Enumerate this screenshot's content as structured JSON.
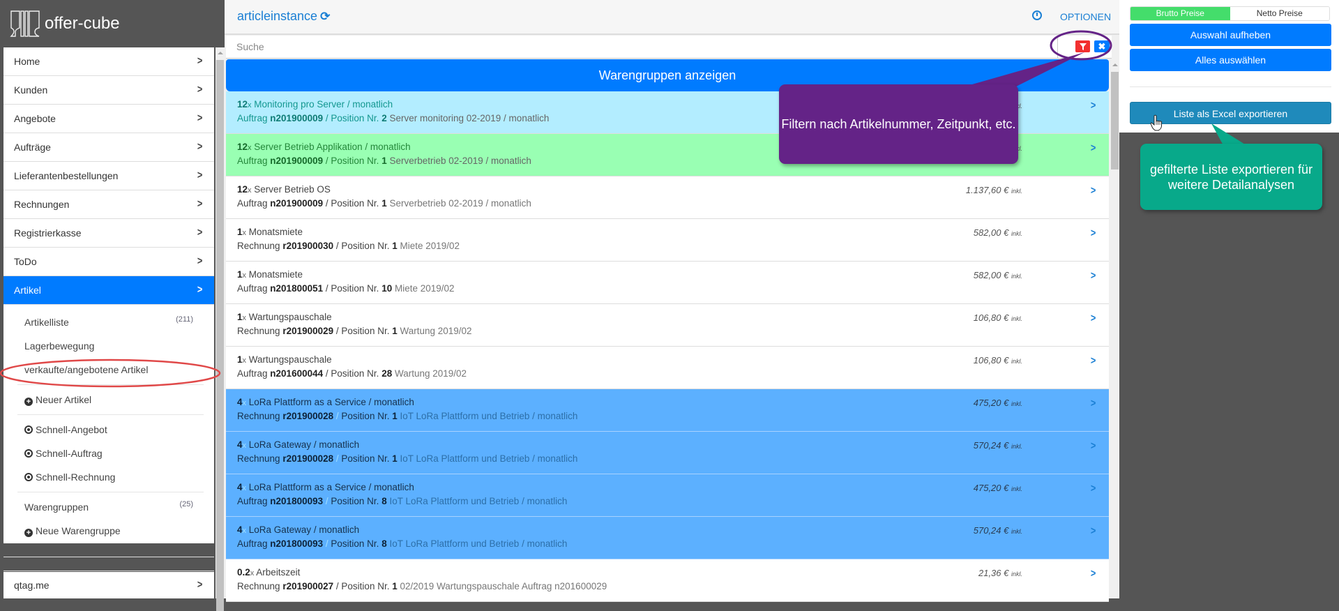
{
  "app": {
    "name": "offer-cube"
  },
  "sidebar": {
    "nav_items": [
      {
        "label": "Home"
      },
      {
        "label": "Kunden"
      },
      {
        "label": "Angebote"
      },
      {
        "label": "Aufträge"
      },
      {
        "label": "Lieferantenbestellungen"
      },
      {
        "label": "Rechnungen"
      },
      {
        "label": "Registrierkasse"
      },
      {
        "label": "ToDo"
      },
      {
        "label": "Artikel",
        "active": true
      }
    ],
    "sub_items": [
      {
        "label": "Artikelliste",
        "count": "(211)"
      },
      {
        "label": "Lagerbewegung"
      },
      {
        "label": "verkaufte/angebotene Artikel",
        "highlighted": true
      },
      {
        "label": "Neuer Artikel",
        "icon": "plus-circle-icon"
      },
      {
        "label": "Schnell-Angebot",
        "icon": "dot-circle-icon"
      },
      {
        "label": "Schnell-Auftrag",
        "icon": "dot-circle-icon"
      },
      {
        "label": "Schnell-Rechnung",
        "icon": "dot-circle-icon"
      },
      {
        "label": "Warengruppen",
        "count": "(25)"
      },
      {
        "label": "Neue Warengruppe",
        "icon": "plus-circle-icon"
      }
    ],
    "footer_item": {
      "label": "qtag.me"
    }
  },
  "main": {
    "title": "articleinstance",
    "options_label": "OPTIONEN",
    "search": {
      "placeholder": "Suche",
      "value": ""
    },
    "groups_button": "Warengruppen anzeigen",
    "rows": [
      {
        "style": "cyan",
        "qty": "12",
        "name": "Monitoring pro Server / monatlich",
        "doc_type": "Auftrag",
        "doc_no": "n201900009",
        "pos_label": "Position Nr.",
        "pos": "2",
        "desc": "Server monitoring 02-2019 / monatlich",
        "price": "",
        "inkl": "inkl."
      },
      {
        "style": "green",
        "qty": "12",
        "name": "Server Betrieb Applikation / monatlich",
        "doc_type": "Auftrag",
        "doc_no": "n201900009",
        "pos_label": "Position Nr.",
        "pos": "1",
        "desc": "Serverbetrieb 02-2019 / monatlich",
        "price": "",
        "inkl": "inkl."
      },
      {
        "style": "white",
        "qty": "12",
        "name": "Server Betrieb OS",
        "doc_type": "Auftrag",
        "doc_no": "n201900009",
        "pos_label": "Position Nr.",
        "pos": "1",
        "desc": "Serverbetrieb 02-2019 / monatlich",
        "price": "1.137,60 €",
        "inkl": "inkl."
      },
      {
        "style": "white",
        "qty": "1",
        "name": "Monatsmiete",
        "doc_type": "Rechnung",
        "doc_no": "r201900030",
        "pos_label": "Position Nr.",
        "pos": "1",
        "desc": "Miete 2019/02",
        "price": "582,00 €",
        "inkl": "inkl."
      },
      {
        "style": "white",
        "qty": "1",
        "name": "Monatsmiete",
        "doc_type": "Auftrag",
        "doc_no": "n201800051",
        "pos_label": "Position Nr.",
        "pos": "10",
        "desc": "Miete 2019/02",
        "price": "582,00 €",
        "inkl": "inkl."
      },
      {
        "style": "white",
        "qty": "1",
        "name": "Wartungspauschale",
        "doc_type": "Rechnung",
        "doc_no": "r201900029",
        "pos_label": "Position Nr.",
        "pos": "1",
        "desc": "Wartung 2019/02",
        "price": "106,80 €",
        "inkl": "inkl."
      },
      {
        "style": "white",
        "qty": "1",
        "name": "Wartungspauschale",
        "doc_type": "Auftrag",
        "doc_no": "n201600044",
        "pos_label": "Position Nr.",
        "pos": "28",
        "desc": "Wartung 2019/02",
        "price": "106,80 €",
        "inkl": "inkl."
      },
      {
        "style": "blue",
        "qty": "4",
        "name": "LoRa Plattform as a Service / monatlich",
        "doc_type": "Rechnung",
        "doc_no": "r201900028",
        "pos_label": "Position Nr.",
        "pos": "1",
        "desc": "IoT LoRa Plattform und Betrieb / monatlich",
        "price": "475,20 €",
        "inkl": "inkl."
      },
      {
        "style": "blue",
        "qty": "4",
        "name": "LoRa Gateway / monatlich",
        "doc_type": "Rechnung",
        "doc_no": "r201900028",
        "pos_label": "Position Nr.",
        "pos": "1",
        "desc": "IoT LoRa Plattform und Betrieb / monatlich",
        "price": "570,24 €",
        "inkl": "inkl."
      },
      {
        "style": "blue",
        "qty": "4",
        "name": "LoRa Plattform as a Service / monatlich",
        "doc_type": "Auftrag",
        "doc_no": "n201800093",
        "pos_label": "Position Nr.",
        "pos": "8",
        "desc": "IoT LoRa Plattform und Betrieb / monatlich",
        "price": "475,20 €",
        "inkl": "inkl."
      },
      {
        "style": "blue",
        "qty": "4",
        "name": "LoRa Gateway / monatlich",
        "doc_type": "Auftrag",
        "doc_no": "n201800093",
        "pos_label": "Position Nr.",
        "pos": "8",
        "desc": "IoT LoRa Plattform und Betrieb / monatlich",
        "price": "570,24 €",
        "inkl": "inkl."
      },
      {
        "style": "white",
        "qty": "0.2",
        "name": "Arbeitszeit",
        "doc_type": "Rechnung",
        "doc_no": "r201900027",
        "pos_label": "Position Nr.",
        "pos": "1",
        "desc": "02/2019 Wartungspauschale Auftrag n201600029",
        "price": "21,36 €",
        "inkl": "inkl."
      }
    ]
  },
  "right_panel": {
    "price_toggle": {
      "brutto": "Brutto Preise",
      "netto": "Netto Preise",
      "selected": "brutto"
    },
    "deselect_button": "Auswahl aufheben",
    "select_all_button": "Alles auswählen",
    "export_button": "Liste als Excel exportieren"
  },
  "annotations": {
    "filter_callout": "Filtern nach Artikelnummer, Zeitpunkt, etc.",
    "export_callout": "gefilterte Liste exportieren für weitere Detailanalysen"
  },
  "colors": {
    "accent": "#007bff",
    "active_toggle": "#44dd6b",
    "filter_button": "#f23030",
    "export_button": "#1f8abb",
    "filter_callout": "#642387",
    "export_callout": "#08a98a",
    "annotation_ellipse_red": "#e04848",
    "annotation_ellipse_purple": "#642387"
  }
}
